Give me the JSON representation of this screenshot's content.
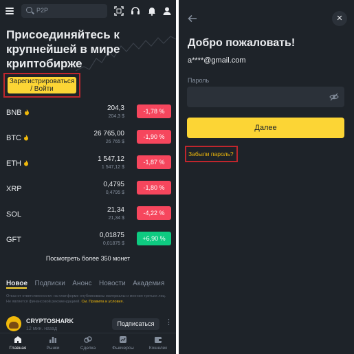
{
  "left": {
    "search": {
      "placeholder": "P2P"
    },
    "hero_title": "Присоединяйтесь к крупнейшей в мире криптобирже",
    "signup_button": "Зарегистрироваться / Войти",
    "coins": [
      {
        "symbol": "BNB",
        "hot": true,
        "price": "204,3",
        "sub": "204,3 $",
        "change": "-1,78 %",
        "direction": "down"
      },
      {
        "symbol": "BTC",
        "hot": true,
        "price": "26 765,00",
        "sub": "26 765 $",
        "change": "-1,90 %",
        "direction": "down"
      },
      {
        "symbol": "ETH",
        "hot": true,
        "price": "1 547,12",
        "sub": "1 547,12 $",
        "change": "-1,87 %",
        "direction": "down"
      },
      {
        "symbol": "XRP",
        "hot": false,
        "price": "0,4795",
        "sub": "0,4795 $",
        "change": "-1,80 %",
        "direction": "down"
      },
      {
        "symbol": "SOL",
        "hot": false,
        "price": "21,34",
        "sub": "21,34 $",
        "change": "-4,22 %",
        "direction": "down"
      },
      {
        "symbol": "GFT",
        "hot": false,
        "price": "0,01875",
        "sub": "0,01875 $",
        "change": "+6,90 %",
        "direction": "up"
      }
    ],
    "more_link": "Посмотреть более 350 монет",
    "news_tabs": [
      "Новое",
      "Подписки",
      "Анонс",
      "Новости",
      "Академия"
    ],
    "disclaimer": {
      "text": "Отказ от ответственности: на платформе опубликованы материалы и мнения третьих лиц. Не является финансовой рекомендацией.",
      "link": "См. Правила и условия."
    },
    "post": {
      "author": "CRYPTOSHARK",
      "time": "12 мин. назад",
      "subscribe": "Подписаться"
    },
    "bottom_nav": [
      "Главная",
      "Рынки",
      "Сделка",
      "Фьючерсы",
      "Кошелек"
    ]
  },
  "right": {
    "title": "Добро пожаловать!",
    "email": "a****@gmail.com",
    "password_label": "Пароль",
    "next_button": "Далее",
    "forgot_link": "Забыли пароль?"
  },
  "colors": {
    "background": "#1e2329",
    "accent": "#fcd535",
    "negative": "#f6465d",
    "positive": "#0ecb81",
    "highlight_box": "#c0262d"
  }
}
